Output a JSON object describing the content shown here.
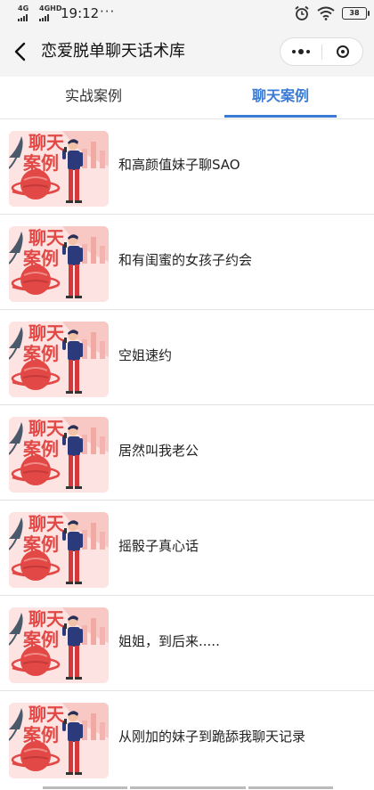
{
  "status_bar": {
    "net_left": "4G",
    "net_right": "4GHD",
    "time": "19:12",
    "dots": "···",
    "battery": "38",
    "icons": [
      "alarm-icon",
      "wifi-icon",
      "battery-icon"
    ]
  },
  "nav": {
    "title": "恋爱脱单聊天话术库",
    "back_icon": "chevron-left-icon",
    "more_icon": "more-dots-icon",
    "close_icon": "target-close-icon"
  },
  "tabs": [
    {
      "label": "实战案例",
      "active": false
    },
    {
      "label": "聊天案例",
      "active": true
    }
  ],
  "colors": {
    "accent": "#3a7bd5",
    "thumb_title": "#e24845",
    "thumb_bg": "#fde0de"
  },
  "items": [
    {
      "thumb_line1": "聊天",
      "thumb_line2": "案例",
      "title": "和高颜值妹子聊SAO"
    },
    {
      "thumb_line1": "聊天",
      "thumb_line2": "案例",
      "title": "和有闺蜜的女孩子约会"
    },
    {
      "thumb_line1": "聊天",
      "thumb_line2": "案例",
      "title": "空姐速约"
    },
    {
      "thumb_line1": "聊天",
      "thumb_line2": "案例",
      "title": "居然叫我老公"
    },
    {
      "thumb_line1": "聊天",
      "thumb_line2": "案例",
      "title": "摇骰子真心话"
    },
    {
      "thumb_line1": "聊天",
      "thumb_line2": "案例",
      "title": "姐姐，到后来....."
    },
    {
      "thumb_line1": "聊天",
      "thumb_line2": "案例",
      "title": "从刚加的妹子到跪舔我聊天记录"
    }
  ]
}
